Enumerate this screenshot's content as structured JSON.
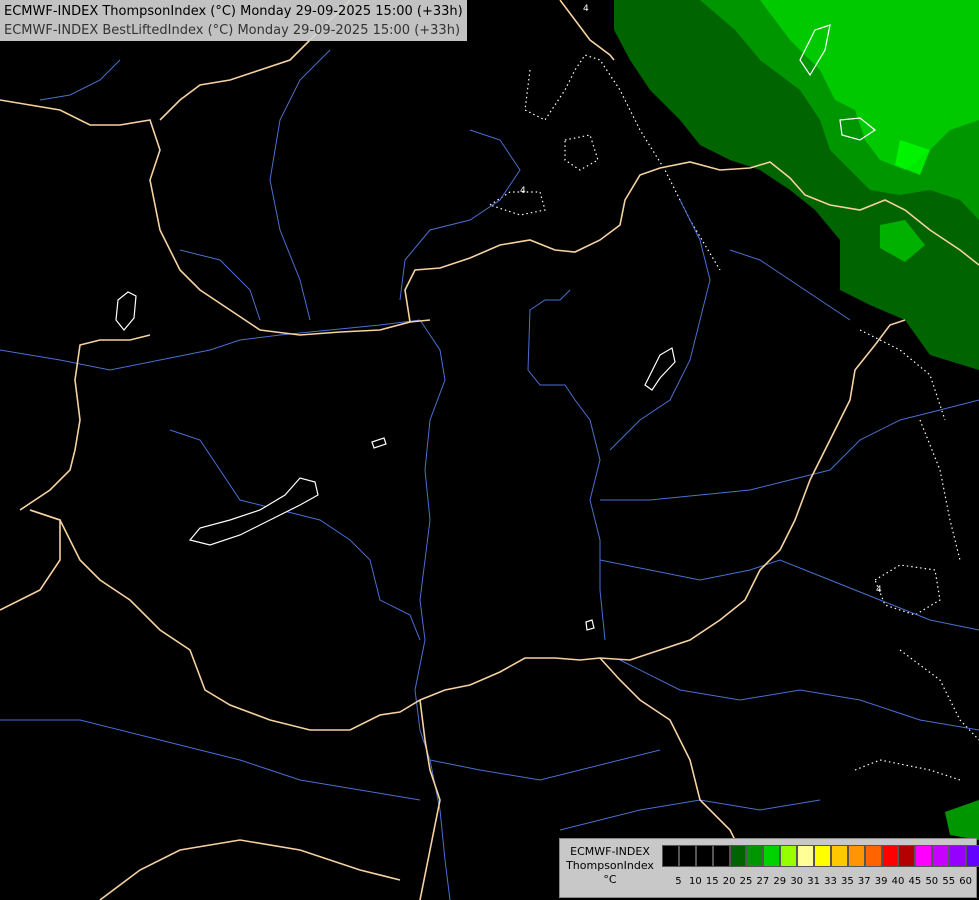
{
  "header": {
    "line1": "ECMWF-INDEX ThompsonIndex (°C) Monday 29-09-2025 15:00 (+33h)",
    "line2": "ECMWF-INDEX BestLiftedIndex (°C) Monday 29-09-2025 15:00 (+33h)"
  },
  "map": {
    "background_color": "#000000",
    "border_color": "#f5d2a0",
    "river_color": "#4a6fd0",
    "contour_color": "#ffffff",
    "contour_labels": [
      "4",
      "4",
      "4"
    ]
  },
  "legend": {
    "title_lines": [
      "ECMWF-INDEX",
      "ThompsonIndex",
      "°C"
    ],
    "colors": [
      "#000000",
      "#000000",
      "#000000",
      "#000000",
      "#006400",
      "#009600",
      "#00d200",
      "#96ff00",
      "#ffff96",
      "#ffff00",
      "#ffc800",
      "#ff9600",
      "#ff6400",
      "#ff0000",
      "#b40000",
      "#ff00ff",
      "#c800ff",
      "#9600ff",
      "#6400ff",
      "#0000ff"
    ],
    "ticks": [
      "5",
      "10",
      "15",
      "20",
      "25",
      "27",
      "29",
      "30",
      "31",
      "33",
      "35",
      "37",
      "39",
      "40",
      "45",
      "50",
      "55",
      "60"
    ]
  }
}
